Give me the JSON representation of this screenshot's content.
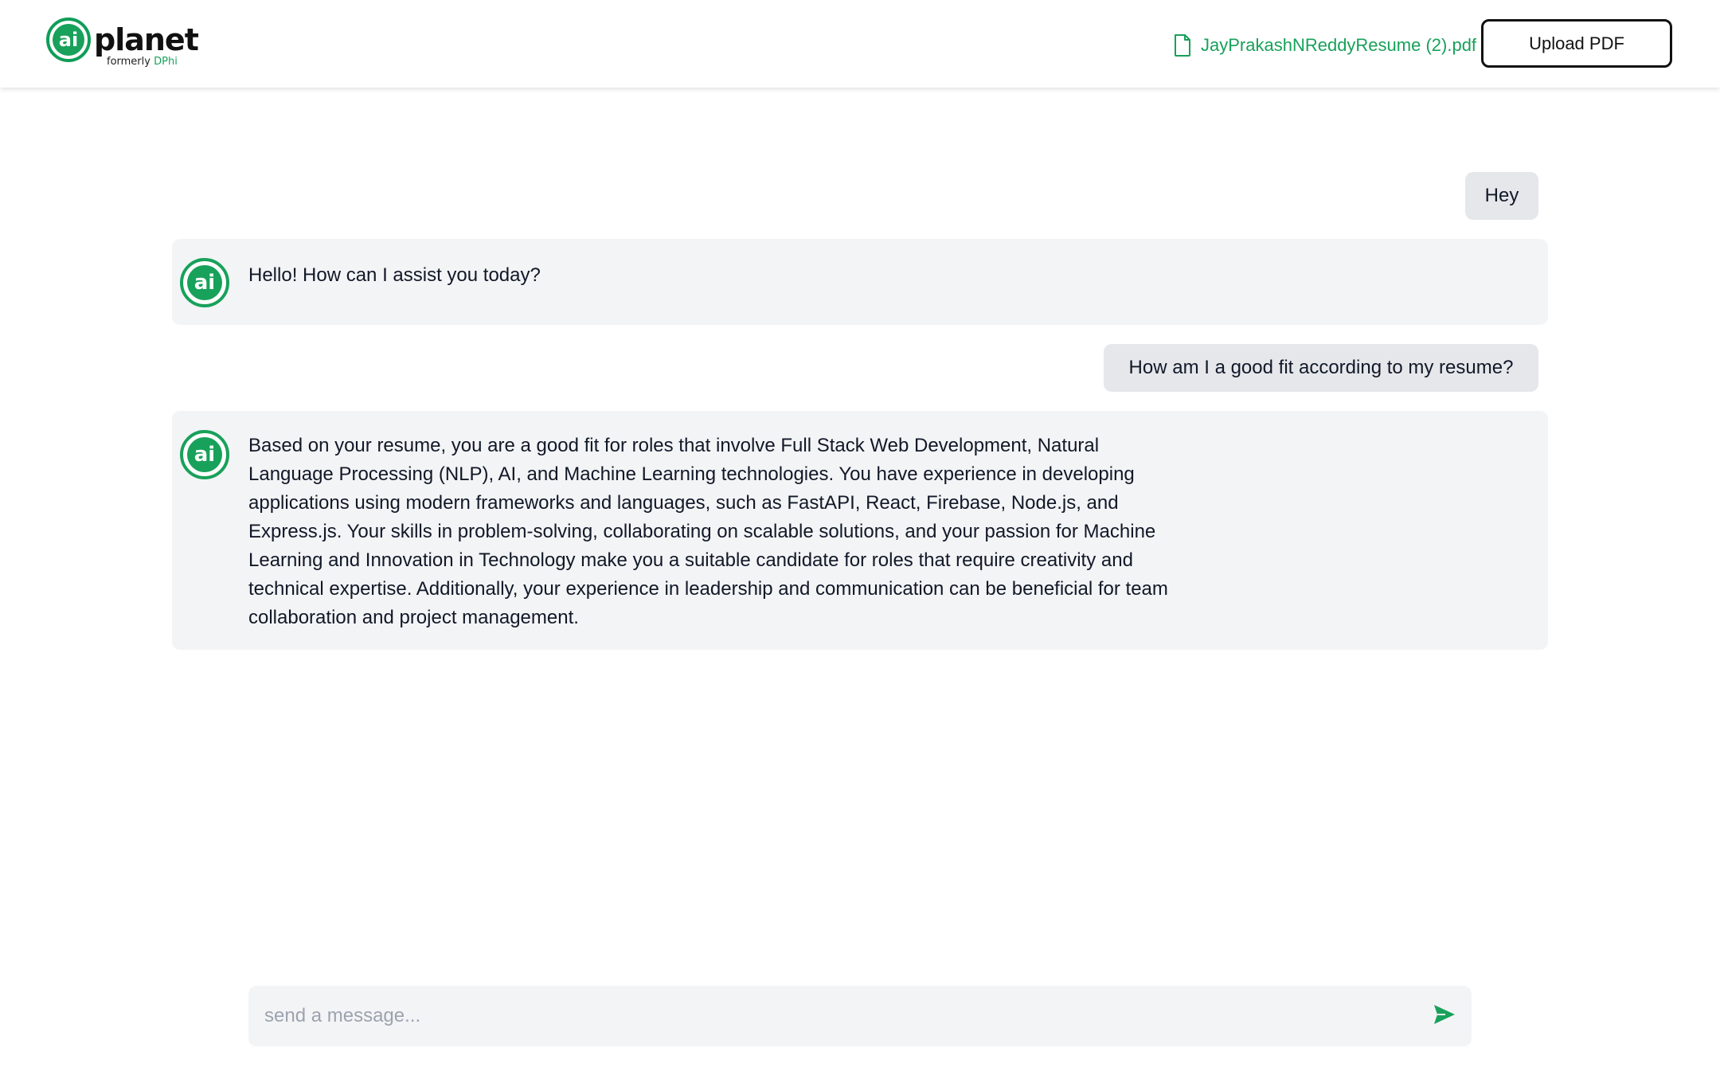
{
  "header": {
    "logo": {
      "badge": "ai",
      "word": "planet",
      "sub_prefix": "formerly",
      "sub_accent": "DPhi"
    },
    "file_name": "JayPrakashNReddyResume (2).pdf",
    "upload_label": "Upload PDF"
  },
  "messages": [
    {
      "role": "user",
      "text": "Hey"
    },
    {
      "role": "assistant",
      "avatar": "ai",
      "text": "Hello! How can I assist you today?"
    },
    {
      "role": "user",
      "text": "How am I a good fit according to my resume?"
    },
    {
      "role": "assistant",
      "avatar": "ai",
      "text": "Based on your resume, you are a good fit for roles that involve Full Stack Web Development, Natural Language Processing (NLP), AI, and Machine Learning technologies. You have experience in developing applications using modern frameworks and languages, such as FastAPI, React, Firebase, Node.js, and Express.js. Your skills in problem-solving, collaborating on scalable solutions, and your passion for Machine Learning and Innovation in Technology make you a suitable candidate for roles that require creativity and technical expertise. Additionally, your experience in leadership and communication can be beneficial for team collaboration and project management."
    }
  ],
  "composer": {
    "placeholder": "send a message..."
  },
  "icons": {
    "file": "file-icon",
    "send": "send-icon"
  },
  "colors": {
    "brand_green": "#18a15a",
    "bubble_user": "#e5e7eb",
    "bubble_bot": "#f3f4f6"
  }
}
